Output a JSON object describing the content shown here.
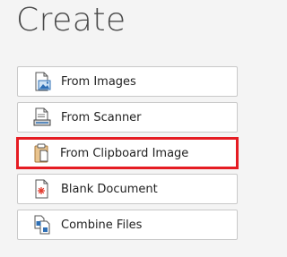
{
  "header": {
    "title": "Create"
  },
  "buttons": [
    {
      "label": "From Images",
      "icon": "image-file-icon"
    },
    {
      "label": "From Scanner",
      "icon": "scanner-icon"
    },
    {
      "label": "From Clipboard Image",
      "icon": "clipboard-icon",
      "selected": true
    },
    {
      "label": "Blank Document",
      "icon": "blank-document-icon"
    },
    {
      "label": "Combine Files",
      "icon": "combine-files-icon"
    }
  ],
  "colors": {
    "background": "#f4f4f4",
    "button_border": "#c9c9c9",
    "highlight": "#e51c23",
    "icon_blue": "#2e6fb5",
    "icon_red": "#e33b2e"
  }
}
